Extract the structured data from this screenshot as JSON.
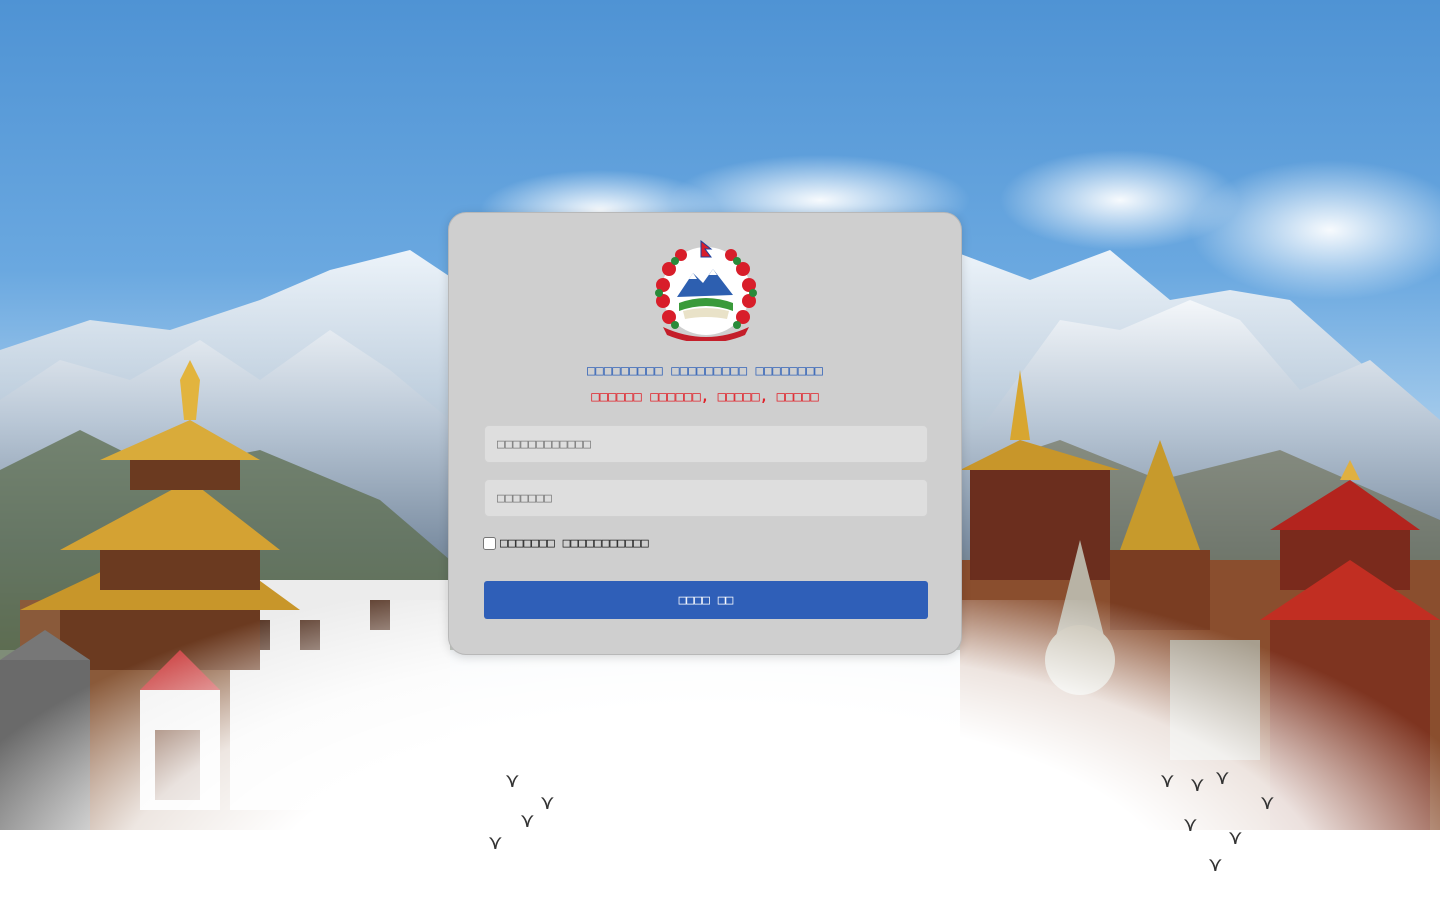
{
  "login": {
    "title_primary": "□□□□□□□□□ □□□□□□□□□ □□□□□□□□",
    "title_secondary": "□□□□□□ □□□□□□, □□□□□, □□□□□",
    "username_placeholder": "□□□□□□□□□□□□",
    "password_placeholder": "□□□□□□□",
    "remember_label": "□□□□□□□ □□□□□□□□□□□",
    "submit_label": "□□□□ □□"
  },
  "colors": {
    "title_primary": "#3565b8",
    "title_secondary": "#e0232b",
    "button": "#2f5fb8",
    "card": "#cfcfcf"
  },
  "icons": {
    "emblem": "nepal-emblem-icon"
  }
}
